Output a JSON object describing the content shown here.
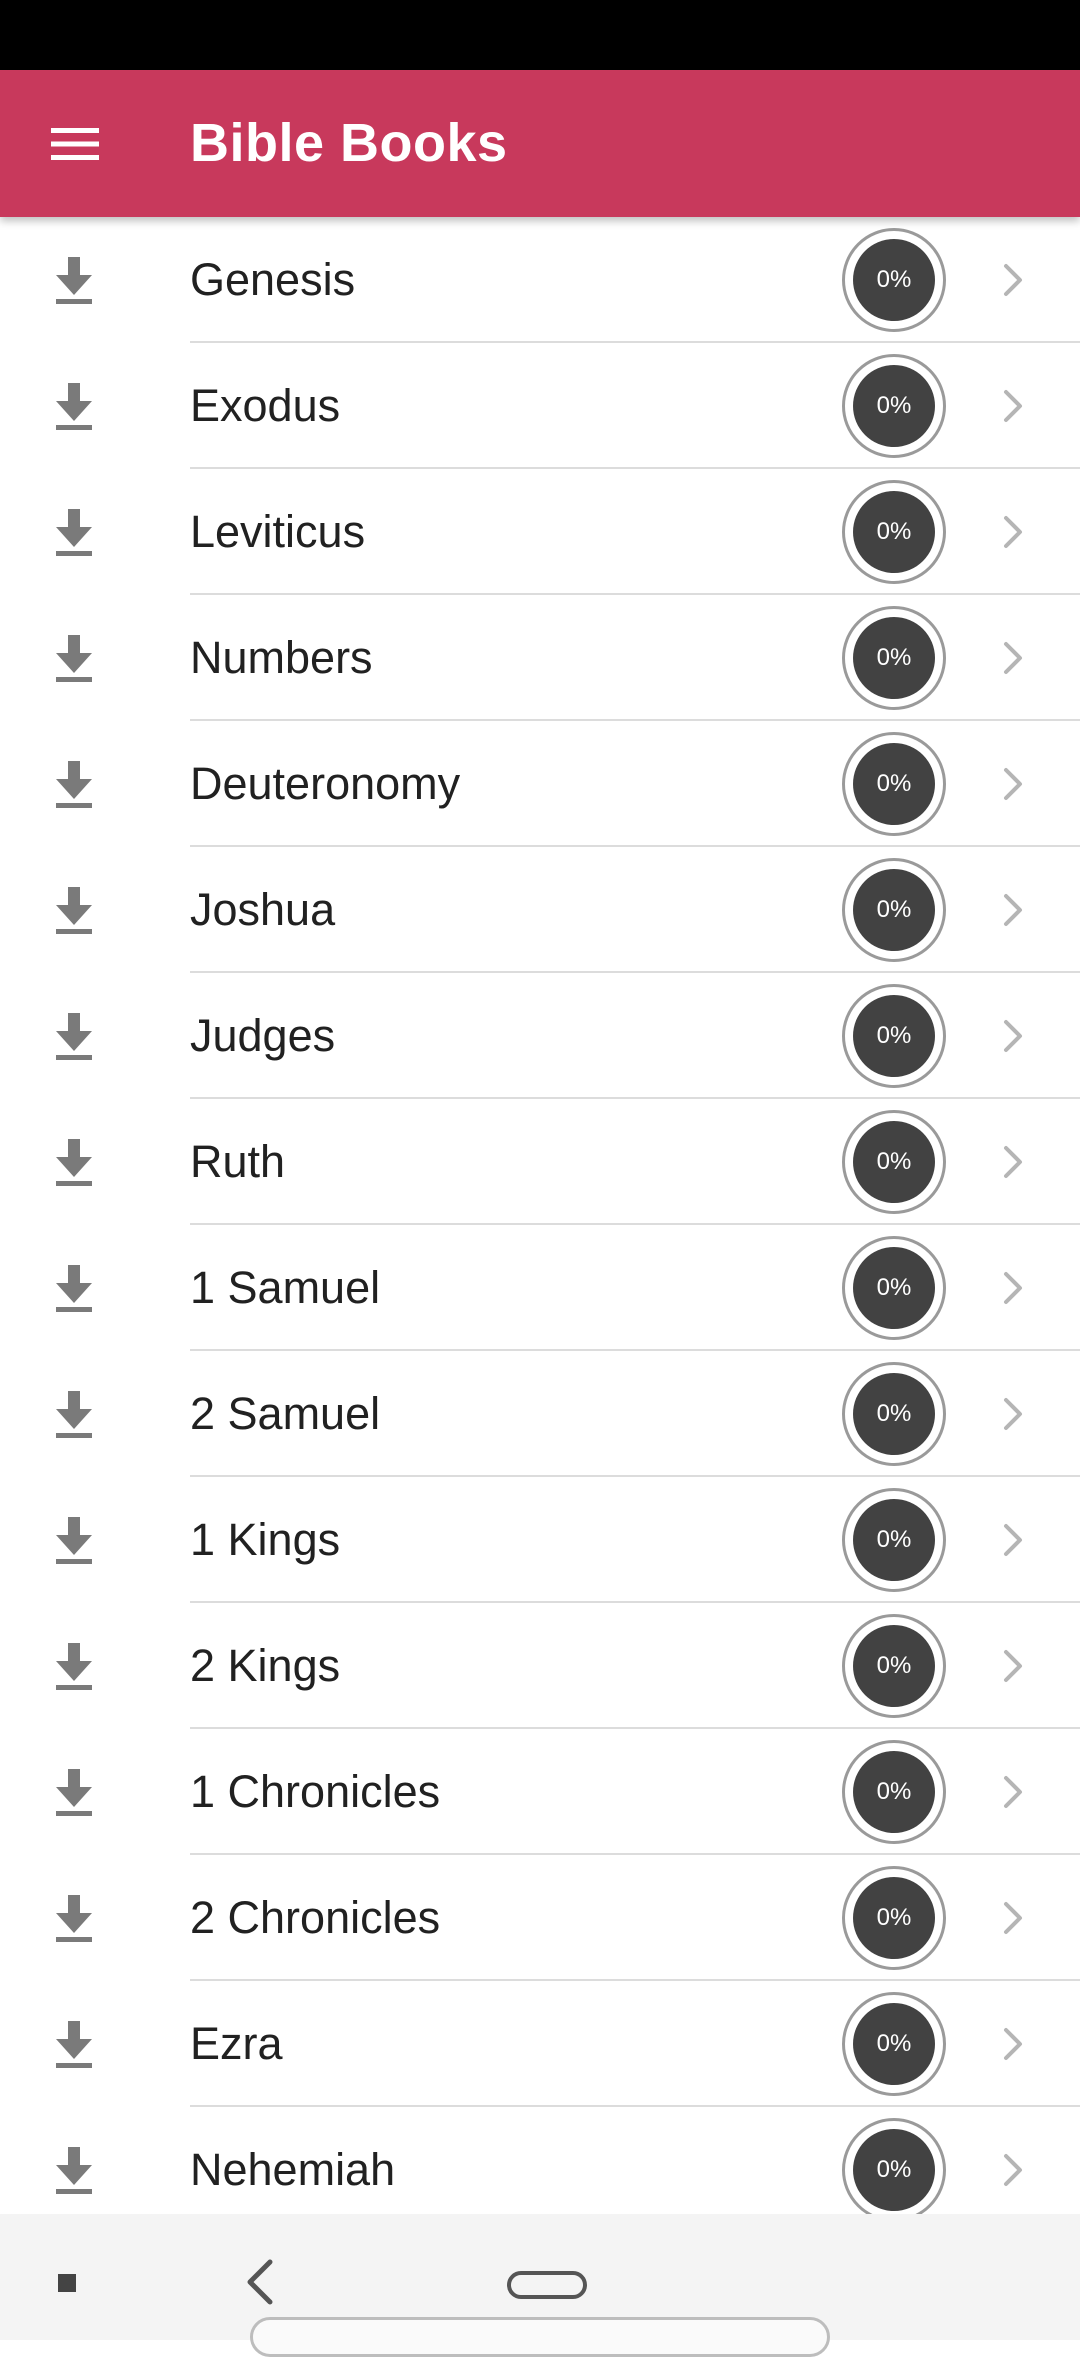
{
  "app_bar": {
    "title": "Bible Books",
    "menu_icon": "hamburger-menu-icon",
    "color": "#c8395c"
  },
  "books": [
    {
      "name": "Genesis",
      "progress": "0%"
    },
    {
      "name": "Exodus",
      "progress": "0%"
    },
    {
      "name": "Leviticus",
      "progress": "0%"
    },
    {
      "name": "Numbers",
      "progress": "0%"
    },
    {
      "name": "Deuteronomy",
      "progress": "0%"
    },
    {
      "name": "Joshua",
      "progress": "0%"
    },
    {
      "name": "Judges",
      "progress": "0%"
    },
    {
      "name": "Ruth",
      "progress": "0%"
    },
    {
      "name": "1 Samuel",
      "progress": "0%"
    },
    {
      "name": "2 Samuel",
      "progress": "0%"
    },
    {
      "name": "1 Kings",
      "progress": "0%"
    },
    {
      "name": "2 Kings",
      "progress": "0%"
    },
    {
      "name": "1 Chronicles",
      "progress": "0%"
    },
    {
      "name": "2 Chronicles",
      "progress": "0%"
    },
    {
      "name": "Ezra",
      "progress": "0%"
    },
    {
      "name": "Nehemiah",
      "progress": "0%"
    }
  ],
  "row_icons": {
    "leading": "download-icon",
    "trailing": "chevron-right-icon"
  },
  "nav_bar": {
    "recents": "recents-icon",
    "back": "back-icon",
    "home": "home-icon"
  }
}
